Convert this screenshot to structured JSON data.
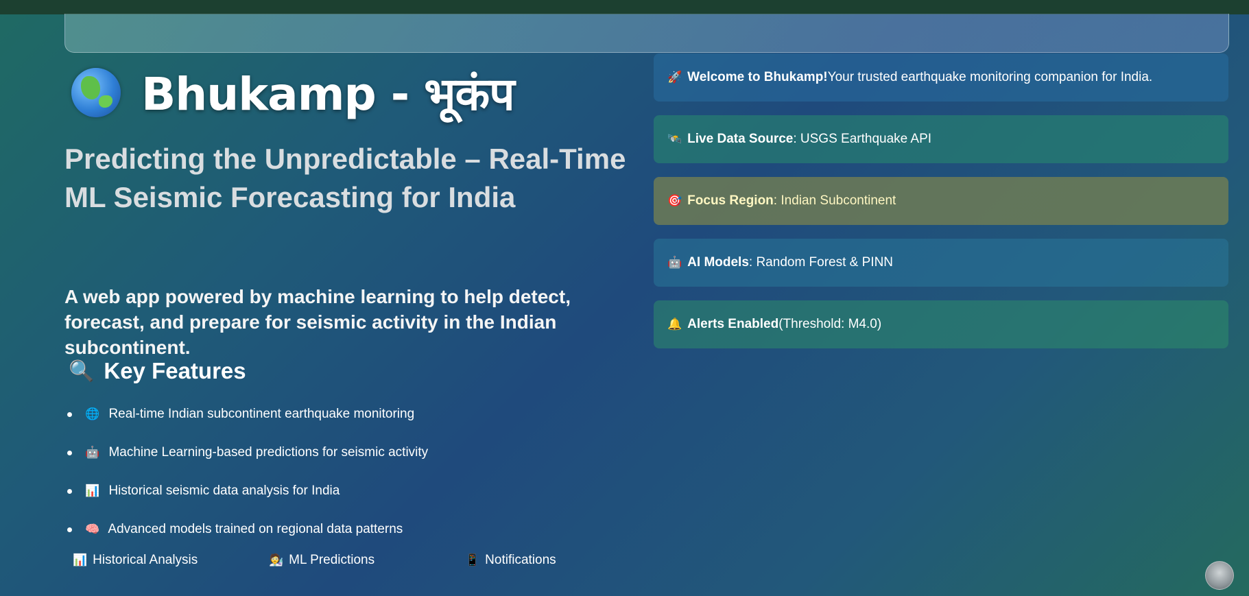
{
  "header": {
    "title": "Bhukamp - भूकंप",
    "logo_icon": "globe-icon",
    "subtitle": "Predicting the Unpredictable – Real-Time ML Seismic Forecasting for India",
    "description": "A web app powered by machine learning to help detect, forecast, and prepare for seismic activity in the Indian subcontinent."
  },
  "features": {
    "heading_icon": "🔍",
    "heading": "Key Features",
    "items": [
      {
        "icon": "🌐",
        "text": "Real-time Indian subcontinent earthquake monitoring"
      },
      {
        "icon": "🤖",
        "text": "Machine Learning-based predictions for seismic activity"
      },
      {
        "icon": "📊",
        "text": "Historical seismic data analysis for India"
      },
      {
        "icon": "🧠",
        "text": "Advanced models trained on regional data patterns"
      }
    ]
  },
  "nav": [
    {
      "icon": "📊",
      "label": "Historical Analysis"
    },
    {
      "icon": "🧑‍🔬",
      "label": "ML Predictions"
    },
    {
      "icon": "📱",
      "label": "Notifications"
    }
  ],
  "cards": [
    {
      "icon": "🚀",
      "bold": "Welcome to Bhukamp!",
      "text": " Your trusted earthquake monitoring companion for India."
    },
    {
      "icon": "🛰️",
      "bold": "Live Data Source",
      "text": ": USGS Earthquake API"
    },
    {
      "icon": "🎯",
      "bold": "Focus Region",
      "text": ": Indian Subcontinent"
    },
    {
      "icon": "🤖",
      "bold": "AI Models",
      "text": ": Random Forest & PINN"
    },
    {
      "icon": "🔔",
      "bold": "Alerts Enabled",
      "text": " (Threshold: M4.0)"
    }
  ],
  "colors": {
    "topbar": "#1c4030",
    "card_focus_text": "#fff7c2"
  }
}
